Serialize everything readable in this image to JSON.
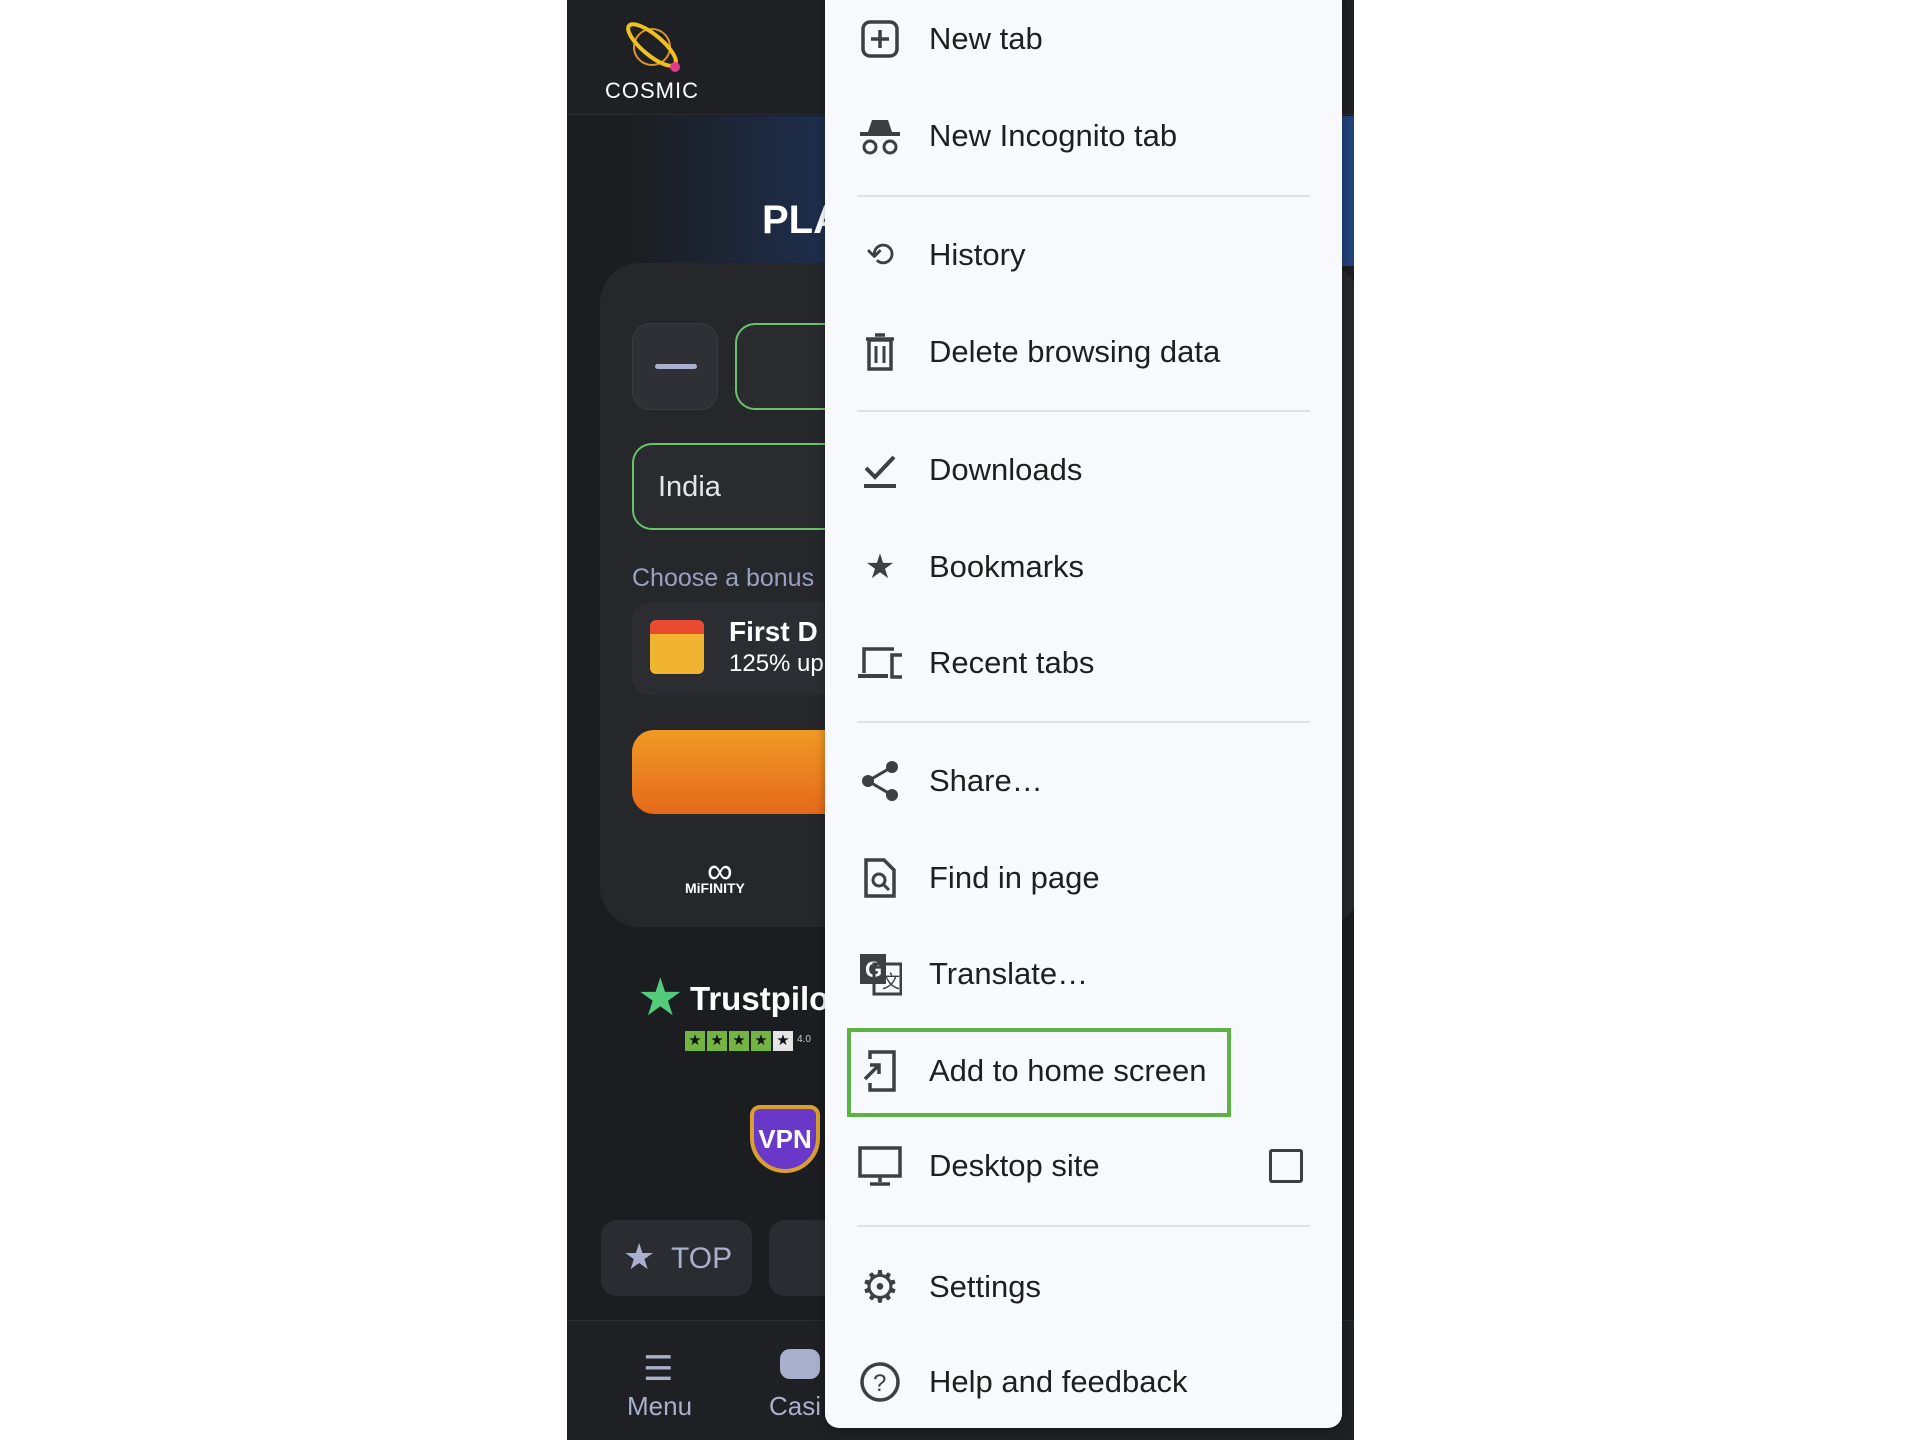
{
  "page": {
    "logo_text": "COSMIC",
    "banner_text": "PLA",
    "country_field": "India",
    "bonus_label": "Choose a bonus",
    "bonus_title": "First D",
    "bonus_subtitle": "125% up",
    "payment_logo": "MiFINITY",
    "trustpilot": "Trustpilot",
    "trustpilot_score": "4.0",
    "trustpilot_rating": 4,
    "vpn_badge": "VPN",
    "top_button": "TOP",
    "nav": {
      "menu": "Menu",
      "casino": "Casi"
    }
  },
  "menu": {
    "items": [
      {
        "label": "New tab",
        "icon": "plus-box-icon"
      },
      {
        "label": "New Incognito tab",
        "icon": "incognito-icon"
      },
      {
        "label": "History",
        "icon": "history-icon"
      },
      {
        "label": "Delete browsing data",
        "icon": "trash-icon"
      },
      {
        "label": "Downloads",
        "icon": "download-check-icon"
      },
      {
        "label": "Bookmarks",
        "icon": "star-icon"
      },
      {
        "label": "Recent tabs",
        "icon": "devices-icon"
      },
      {
        "label": "Share…",
        "icon": "share-icon"
      },
      {
        "label": "Find in page",
        "icon": "find-in-page-icon"
      },
      {
        "label": "Translate…",
        "icon": "translate-icon"
      },
      {
        "label": "Add to home screen",
        "icon": "add-to-home-icon",
        "highlighted": true
      },
      {
        "label": "Desktop site",
        "icon": "monitor-icon",
        "checked": false
      },
      {
        "label": "Settings",
        "icon": "gear-icon"
      },
      {
        "label": "Help and feedback",
        "icon": "help-icon"
      }
    ]
  },
  "colors": {
    "highlight": "#5cb345",
    "accent_orange": "#e5691a",
    "field_border": "#6cc26a"
  }
}
